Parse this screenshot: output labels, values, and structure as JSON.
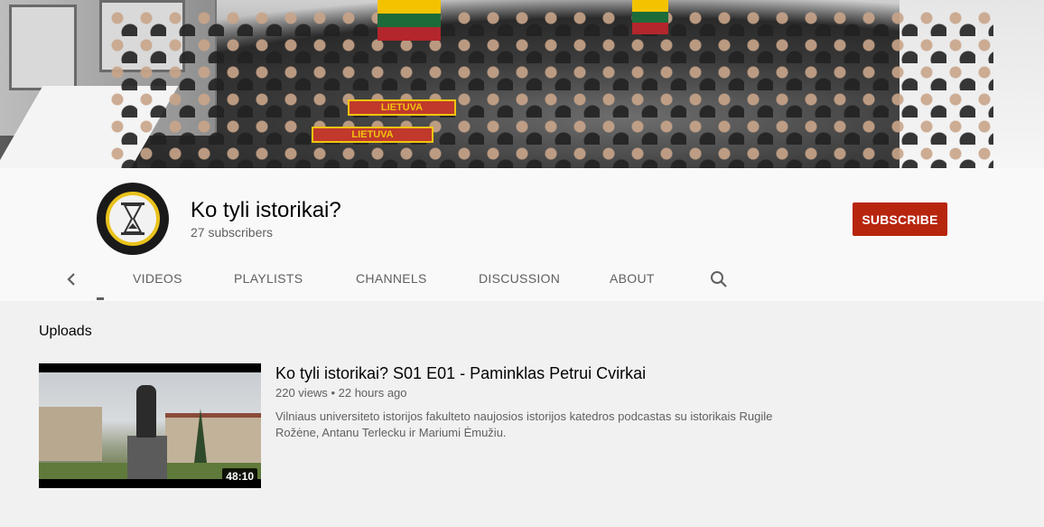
{
  "channel": {
    "name": "Ko tyli istorikai?",
    "subscribers": "27 subscribers",
    "subscribe_label": "SUBSCRIBE",
    "accent_color": "#b8250e"
  },
  "banner": {
    "scarf_text_1": "LIETUVA",
    "scarf_text_2": "LIETUVA"
  },
  "tabs": [
    {
      "label": "VIDEOS"
    },
    {
      "label": "PLAYLISTS"
    },
    {
      "label": "CHANNELS"
    },
    {
      "label": "DISCUSSION"
    },
    {
      "label": "ABOUT"
    }
  ],
  "icons": {
    "back": "chevron-left-icon",
    "search": "search-icon"
  },
  "uploads": {
    "title": "Uploads",
    "videos": [
      {
        "title": "Ko tyli istorikai? S01 E01 - Paminklas Petrui Cvirkai",
        "views": "220 views",
        "separator": "•",
        "age": "22 hours ago",
        "description": "Vilniaus universiteto istorijos fakulteto naujosios istorijos katedros podcastas su istorikais Rugile Rožėne, Antanu Terlecku ir Mariumi Ėmužiu.",
        "duration": "48:10"
      }
    ]
  }
}
